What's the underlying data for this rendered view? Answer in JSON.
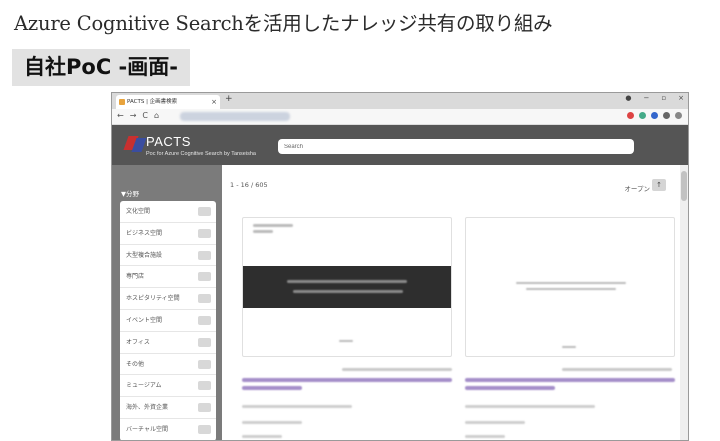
{
  "slide": {
    "title": "Azure Cognitive Searchを活用したナレッジ共有の取り組み",
    "subtitle": "自社PoC -画面-"
  },
  "browser": {
    "tab_title": "PACTS | 企画書検索",
    "new_tab_label": "+",
    "tab_close_label": "×",
    "window_controls": [
      "●",
      "−",
      "▫",
      "×"
    ],
    "nav": {
      "back": "←",
      "forward": "→",
      "reload": "C",
      "home": "⌂"
    },
    "extension_colors": [
      "#d44",
      "#4a8",
      "#36c",
      "#666",
      "#888"
    ]
  },
  "app": {
    "logo_title": "PACTS",
    "logo_subtitle": "Poc for Azure Cognitive Search by Tanseisha",
    "search_placeholder": "Search",
    "brand_colors": {
      "red": "#c8302f",
      "blue": "#3a4da0",
      "header": "#555555"
    }
  },
  "sidebar": {
    "heading": "▼分野",
    "facets": [
      {
        "label": "文化空間"
      },
      {
        "label": "ビジネス空間"
      },
      {
        "label": "大型複合施設"
      },
      {
        "label": "専門店"
      },
      {
        "label": "ホスピタリティ空間"
      },
      {
        "label": "イベント空間"
      },
      {
        "label": "オフィス"
      },
      {
        "label": "その他"
      },
      {
        "label": "ミュージアム"
      },
      {
        "label": "海外、外資企業"
      },
      {
        "label": "バーチャル空間"
      }
    ]
  },
  "results": {
    "count_text": "1 - 16 / 605",
    "sort_label": "オープン",
    "sort_icon": "↑"
  }
}
